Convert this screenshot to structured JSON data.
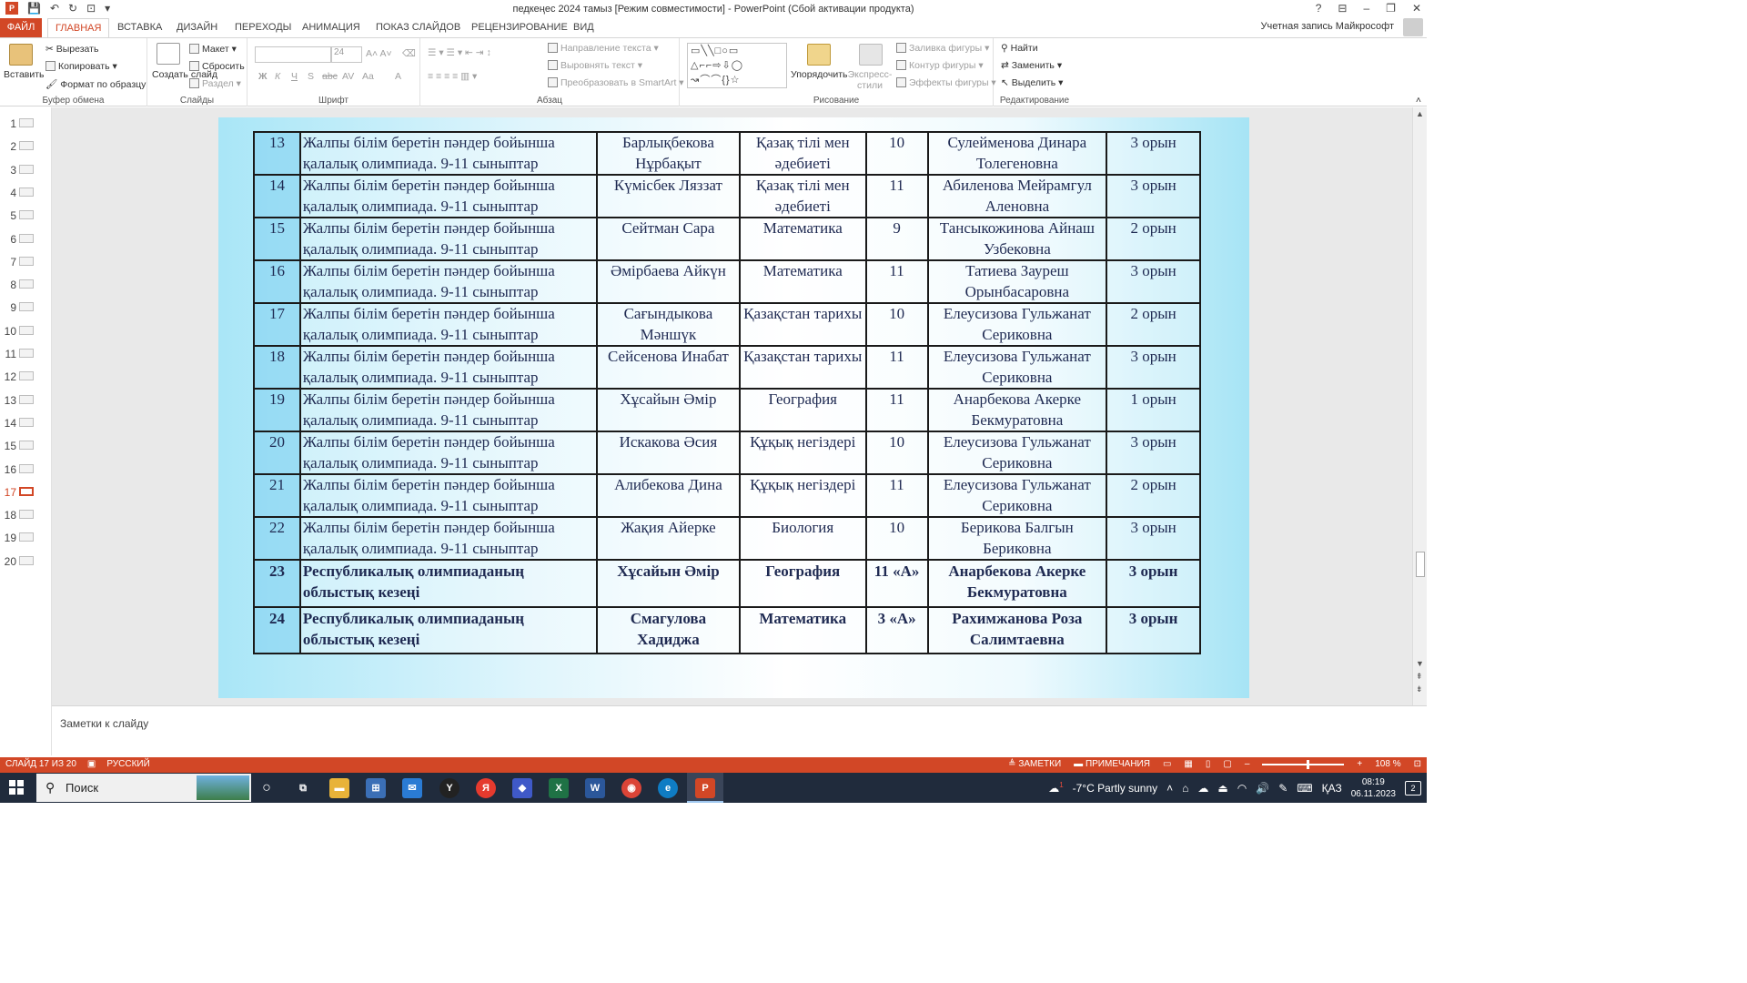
{
  "window": {
    "title": "педкеңес 2024 тамыз [Режим совместимости] - PowerPoint (Сбой активации продукта)",
    "account": "Учетная запись Майкрософт",
    "help": "?",
    "minimize": "–",
    "restore": "❐",
    "close": "✕"
  },
  "tabs": [
    "ФАЙЛ",
    "ГЛАВНАЯ",
    "ВСТАВКА",
    "ДИЗАЙН",
    "ПЕРЕХОДЫ",
    "АНИМАЦИЯ",
    "ПОКАЗ СЛАЙДОВ",
    "РЕЦЕНЗИРОВАНИЕ",
    "ВИД"
  ],
  "ribbon": {
    "clipboard": {
      "label": "Буфер обмена",
      "paste": "Вставить",
      "cut": "Вырезать",
      "copy": "Копировать",
      "format_painter": "Формат по образцу"
    },
    "slides": {
      "label": "Слайды",
      "new_slide": "Создать слайд",
      "layout": "Макет",
      "reset": "Сбросить",
      "section": "Раздел"
    },
    "font": {
      "label": "Шрифт",
      "font_size": "24",
      "bold": "Ж",
      "italic": "К",
      "underline": "Ч",
      "strike": "S",
      "strike2": "abc",
      "spacing": "AV",
      "case": "Aa",
      "color": "A"
    },
    "paragraph": {
      "label": "Абзац",
      "text_direction": "Направление текста",
      "align_text": "Выровнять текст",
      "convert_smartart": "Преобразовать в SmartArt"
    },
    "drawing": {
      "label": "Рисование",
      "shapes_glyphs": "▭╲╲□○▭ △⌐⌐⇨⇩◯ ↝⌒⌒{}☆",
      "arrange": "Упорядочить",
      "quick_styles": "Экспресс-стили",
      "shape_fill": "Заливка фигуры",
      "shape_outline": "Контур фигуры",
      "shape_effects": "Эффекты фигуры"
    },
    "editing": {
      "label": "Редактирование",
      "find": "Найти",
      "replace": "Заменить",
      "select": "Выделить"
    }
  },
  "thumbnails": [
    "1",
    "2",
    "3",
    "4",
    "5",
    "6",
    "7",
    "8",
    "9",
    "10",
    "11",
    "12",
    "13",
    "14",
    "15",
    "16",
    "17",
    "18",
    "19",
    "20"
  ],
  "selected_slide": "17",
  "table": {
    "rows": [
      {
        "num": "13",
        "event": "Жалпы білім беретін пәндер бойынша қалалық олимпиада.  9-11 сыныптар",
        "student": "Барлықбекова Нұрбақыт",
        "subject": "Қазақ тілі мен әдебиеті",
        "grade": "10",
        "teacher": "Сулейменова Динара Толегеновна",
        "place": "3 орын"
      },
      {
        "num": "14",
        "event": "Жалпы білім беретін пәндер бойынша қалалық олимпиада.  9-11 сыныптар",
        "student": "Күмісбек Ляззат",
        "subject": "Қазақ тілі мен әдебиеті",
        "grade": "11",
        "teacher": "Абиленова Мейрамгул Аленовна",
        "place": "3 орын"
      },
      {
        "num": "15",
        "event": "Жалпы білім беретін пәндер бойынша қалалық олимпиада.  9-11 сыныптар",
        "student": "Сейтман Сара",
        "subject": "Математика",
        "grade": "9",
        "teacher": "Тансыкожинова Айнаш Узбековна",
        "place": "2 орын"
      },
      {
        "num": "16",
        "event": "Жалпы білім беретін пәндер бойынша қалалық олимпиада.  9-11 сыныптар",
        "student": "Әмірбаева Айкүн",
        "subject": "Математика",
        "grade": "11",
        "teacher": "Татиева Зауреш Орынбасаровна",
        "place": "3 орын"
      },
      {
        "num": "17",
        "event": "Жалпы білім беретін пәндер бойынша қалалық олимпиада.  9-11 сыныптар",
        "student": "Сағындыкова Мәншүк",
        "subject": "Қазақстан тарихы",
        "grade": "10",
        "teacher": "Елеусизова Гульжанат Сериковна",
        "place": "2 орын"
      },
      {
        "num": "18",
        "event": "Жалпы білім беретін пәндер бойынша қалалық олимпиада.  9-11 сыныптар",
        "student": "Сейсенова Инабат",
        "subject": "Қазақстан тарихы",
        "grade": "11",
        "teacher": "Елеусизова Гульжанат Сериковна",
        "place": "3 орын"
      },
      {
        "num": "19",
        "event": "Жалпы білім беретін пәндер бойынша қалалық олимпиада.  9-11 сыныптар",
        "student": "Хұсайын Әмір",
        "subject": "География",
        "grade": "11",
        "teacher": "Анарбекова Акерке Бекмуратовна",
        "place": "1 орын"
      },
      {
        "num": "20",
        "event": "Жалпы білім беретін пәндер бойынша қалалық олимпиада.  9-11 сыныптар",
        "student": "Искакова Әсия",
        "subject": "Құқық негіздері",
        "grade": "10",
        "teacher": "Елеусизова Гульжанат Сериковна",
        "place": "3 орын"
      },
      {
        "num": "21",
        "event": "Жалпы білім беретін пәндер бойынша қалалық олимпиада.  9-11 сыныптар",
        "student": "Алибекова Дина",
        "subject": "Құқық негіздері",
        "grade": "11",
        "teacher": "Елеусизова Гульжанат Сериковна",
        "place": "2 орын"
      },
      {
        "num": "22",
        "event": "Жалпы білім беретін пәндер бойынша қалалық олимпиада.  9-11 сыныптар",
        "student": "Жақия Айерке",
        "subject": "Биология",
        "grade": "10",
        "teacher": "Берикова Балгын Бериковна",
        "place": "3 орын"
      },
      {
        "num": "23",
        "event": "Республикалық олимпиаданың облыстық кезеңі",
        "student": "Хұсайын Әмір",
        "subject": "География",
        "grade": "11 «А»",
        "teacher": "Анарбекова Акерке Бекмуратовна",
        "place": "3 орын",
        "bold": true
      },
      {
        "num": "24",
        "event": "Республикалық олимпиаданың облыстық кезеңі",
        "student": "Смагулова Хадиджа",
        "subject": "Математика",
        "grade": "3 «А»",
        "teacher": "Рахимжанова Роза Салимтаевна",
        "place": "3 орын",
        "bold": true
      }
    ]
  },
  "notes_placeholder": "Заметки к слайду",
  "status": {
    "slide_info": "СЛАЙД 17 ИЗ 20",
    "language": "РУССКИЙ",
    "notes": "ЗАМЕТКИ",
    "comments": "ПРИМЕЧАНИЯ",
    "zoom": "108 %",
    "zoom_level": 0.54
  },
  "taskbar": {
    "search": "Поиск",
    "weather": "-7°C  Partly sunny",
    "language": "ҚАЗ",
    "time": "08:19",
    "date": "06.11.2023",
    "notifications": "2",
    "weather_badge": "1"
  },
  "colors": {
    "accent": "#d24726",
    "table_text": "#1f2a52",
    "taskbar": "#202b3c"
  }
}
